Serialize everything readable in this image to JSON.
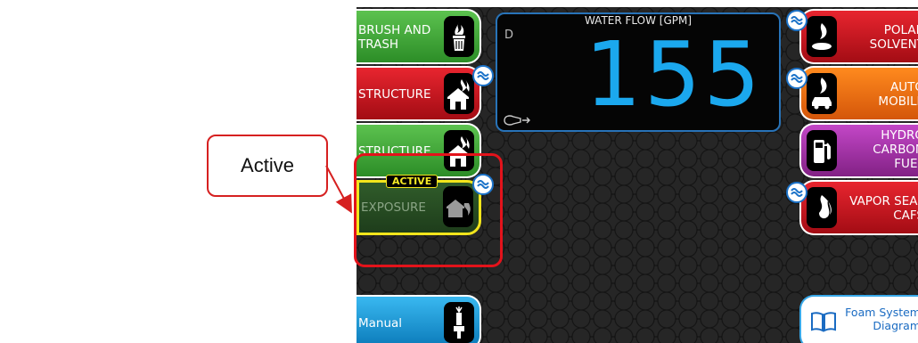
{
  "callout": {
    "text": "Active"
  },
  "flow": {
    "title": "WATER FLOW [GPM]",
    "mode_letter": "D",
    "value": "155"
  },
  "left_buttons": [
    {
      "label_line1": "BRUSH AND",
      "label_line2": "TRASH",
      "icon": "trash-fire-icon",
      "color": "#3fae36"
    },
    {
      "label_line1": "STRUCTURE",
      "label_line2": "",
      "icon": "house-fire-icon",
      "color": "#d81922"
    },
    {
      "label_line1": "STRUCTURE",
      "label_line2": "",
      "icon": "house-fire-icon",
      "color": "#3fae36"
    },
    {
      "label_line1": "EXPOSURE",
      "label_line2": "",
      "icon": "exposure-house-icon",
      "color": "#2a5426",
      "active_tag": "ACTIVE"
    }
  ],
  "right_buttons": [
    {
      "label_line1": "POLAR",
      "label_line2": "SOLVENT",
      "icon": "fire-drop-icon",
      "color": "#d81922"
    },
    {
      "label_line1": "AUTO",
      "label_line2": "MOBILE",
      "icon": "car-fire-icon",
      "color": "#ef6e12"
    },
    {
      "label_line1": "HYDRO",
      "label_line2": "CARBON",
      "label_line3": "FUEL",
      "icon": "fuel-pump-icon",
      "color": "#a32fa8"
    },
    {
      "label_line1": "VAPOR SEAL",
      "label_line2": "CAFS",
      "icon": "flame-icon",
      "color": "#d81922"
    }
  ],
  "manual": {
    "label": "Manual",
    "icon": "nozzle-icon",
    "color": "#1a94d8"
  },
  "foam": {
    "label_line1": "Foam System",
    "label_line2": "Diagram",
    "icon": "book-icon"
  },
  "colors": {
    "accent_blue": "#1ba8ee",
    "active_yellow": "#f2e51c",
    "callout_red": "#d62020"
  }
}
